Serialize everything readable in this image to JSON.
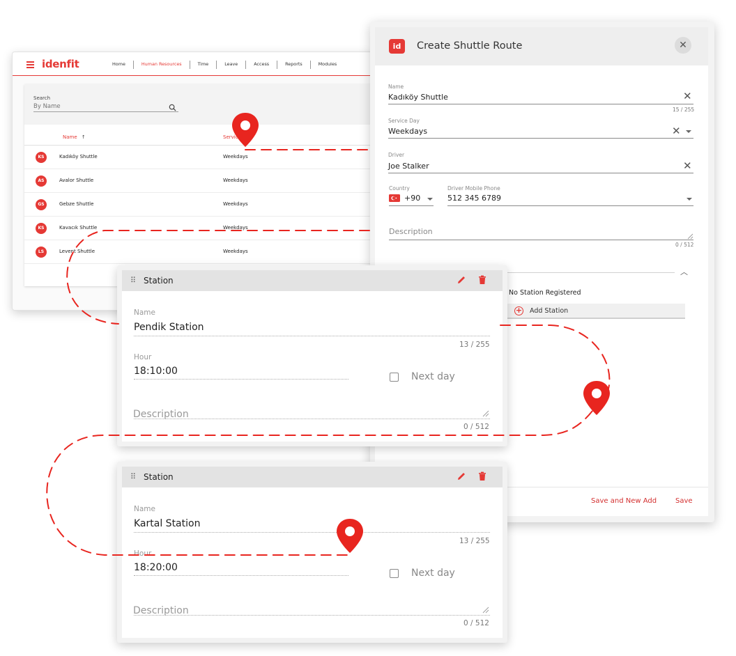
{
  "app": {
    "logo": "idenfit",
    "nav": [
      "Home",
      "Human Resources",
      "Time",
      "Leave",
      "Access",
      "Reports",
      "Modules"
    ],
    "active_nav": "Human Resources"
  },
  "list": {
    "search_label": "Search",
    "search_placeholder": "By Name",
    "col_name": "Name",
    "col_name_sort": "↑",
    "col_day": "Service Day",
    "rows": [
      {
        "initials": "KS",
        "name": "Kadıköy Shuttle",
        "day": "Weekdays"
      },
      {
        "initials": "AS",
        "name": "Avalor Shuttle",
        "day": "Weekdays"
      },
      {
        "initials": "GS",
        "name": "Gebze Shuttle",
        "day": "Weekdays"
      },
      {
        "initials": "KS",
        "name": "Kavacık Shuttle",
        "day": "Weekdays"
      },
      {
        "initials": "LS",
        "name": "Levent Shuttle",
        "day": "Weekdays"
      }
    ]
  },
  "dialog": {
    "logo": "id",
    "title": "Create Shuttle Route",
    "close": "✕",
    "name_label": "Name",
    "name_value": "Kadıköy Shuttle",
    "name_count": "15 / 255",
    "service_label": "Service Day",
    "service_value": "Weekdays",
    "driver_label": "Driver",
    "driver_value": "Joe Stalker",
    "country_label": "Country",
    "country_code": "+90",
    "phone_label": "Driver Mobile Phone",
    "phone_value": "512 345 6789",
    "description_placeholder": "Description",
    "description_count": "0 / 512",
    "no_station": "No Station Registered",
    "add_station": "Add Station",
    "save_new": "Save and New Add",
    "save": "Save"
  },
  "stations": [
    {
      "title": "Station",
      "name_label": "Name",
      "name_value": "Pendik Station",
      "name_count": "13 / 255",
      "hour_label": "Hour",
      "hour_value": "18:10:00",
      "next_day_label": "Next day",
      "description_placeholder": "Description",
      "description_count": "0 / 512"
    },
    {
      "title": "Station",
      "name_label": "Name",
      "name_value": "Kartal Station",
      "name_count": "13 / 255",
      "hour_label": "Hour",
      "hour_value": "18:20:00",
      "next_day_label": "Next day",
      "description_placeholder": "Description",
      "description_count": "0 / 512"
    }
  ],
  "colors": {
    "brand": "#e53935",
    "route_line": "#e8251f"
  }
}
